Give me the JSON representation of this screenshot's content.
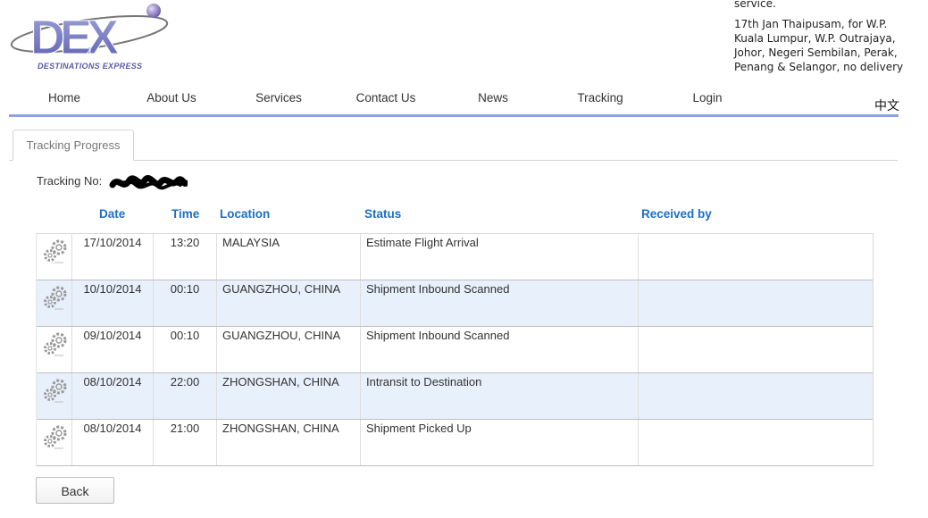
{
  "logo": {
    "text": "DEX",
    "subtitle": "DESTINATIONS EXPRESS"
  },
  "notice": {
    "line1": "service.",
    "line2": "17th Jan Thaipusam, for W.P. Kuala Lumpur, W.P. Outrajaya, Johor, Negeri Sembilan, Perak, Penang & Selangor, no delivery"
  },
  "nav": {
    "items": [
      "Home",
      "About Us",
      "Services",
      "Contact Us",
      "News",
      "Tracking",
      "Login"
    ],
    "language": "中文"
  },
  "tab": {
    "label": "Tracking Progress"
  },
  "tracking": {
    "label": "Tracking No:"
  },
  "table": {
    "headers": {
      "date": "Date",
      "time": "Time",
      "location": "Location",
      "status": "Status",
      "received_by": "Received by"
    },
    "rows": [
      {
        "date": "17/10/2014",
        "time": "13:20",
        "location": "MALAYSIA",
        "status": "Estimate Flight Arrival",
        "received_by": ""
      },
      {
        "date": "10/10/2014",
        "time": "00:10",
        "location": "GUANGZHOU, CHINA",
        "status": "Shipment Inbound Scanned",
        "received_by": ""
      },
      {
        "date": "09/10/2014",
        "time": "00:10",
        "location": "GUANGZHOU, CHINA",
        "status": "Shipment Inbound Scanned",
        "received_by": ""
      },
      {
        "date": "08/10/2014",
        "time": "22:00",
        "location": "ZHONGSHAN, CHINA",
        "status": "Intransit to Destination",
        "received_by": ""
      },
      {
        "date": "08/10/2014",
        "time": "21:00",
        "location": "ZHONGSHAN, CHINA",
        "status": "Shipment Picked Up",
        "received_by": ""
      }
    ]
  },
  "buttons": {
    "back": "Back"
  },
  "colors": {
    "accent_blue": "#1d6fc4",
    "nav_border": "#8ea4d6",
    "row_alt": "#e8f0fb",
    "logo_purple": "#5a5aa8"
  }
}
